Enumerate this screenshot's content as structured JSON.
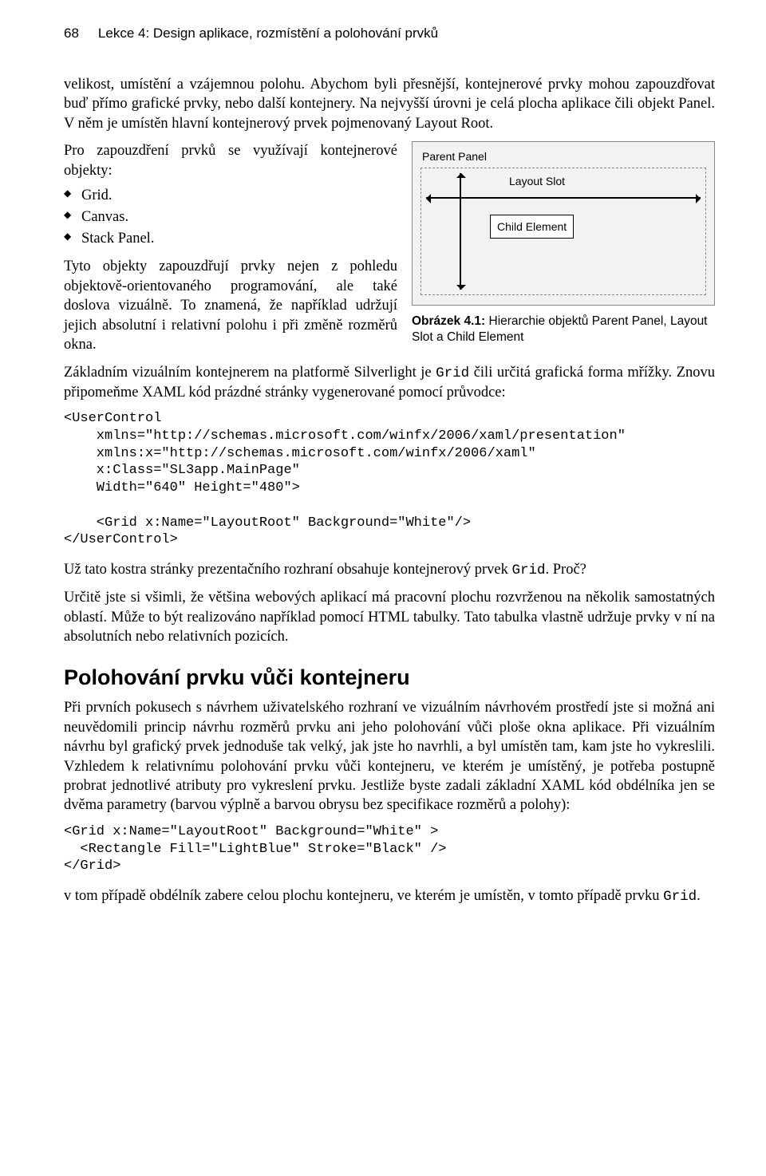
{
  "header": {
    "page_number": "68",
    "title": "Lekce 4: Design aplikace, rozmístění a polohování prvků"
  },
  "p1": "velikost, umístění a vzájemnou polohu. Abychom byli přesnější, kontejnerové prvky mohou zapouzdřovat buď přímo grafické prvky, nebo další kontejnery. Na nejvyšší úrovni je celá plocha aplikace čili objekt Panel. V něm je umístěn hlavní kontejnerový prvek pojmenovaný Layout Root.",
  "p2": "Pro zapouzdření prvků se využívají kontejnerové objekty:",
  "bullets": [
    "Grid.",
    "Canvas.",
    "Stack Panel."
  ],
  "p3": "Tyto objekty zapouzdřují prvky nejen z pohledu objektově-orientovaného programování, ale také doslova vizuálně. To znamená, že například udržují jejich absolutní i relativní polohu i při změně rozměrů okna.",
  "figure": {
    "parent_panel": "Parent Panel",
    "layout_slot": "Layout Slot",
    "child_element": "Child Element",
    "caption_bold": "Obrázek 4.1:",
    "caption_rest": " Hierarchie objektů Parent Panel, Layout Slot a Child Element"
  },
  "p4_pre": "Základním vizuálním kontejnerem na platformě Silverlight je ",
  "p4_code": "Grid",
  "p4_post": " čili určitá grafická forma mřížky. Znovu připomeňme XAML kód prázdné stránky vygenerované pomocí průvodce:",
  "code1": "<UserControl\n    xmlns=\"http://schemas.microsoft.com/winfx/2006/xaml/presentation\"\n    xmlns:x=\"http://schemas.microsoft.com/winfx/2006/xaml\"\n    x:Class=\"SL3app.MainPage\"\n    Width=\"640\" Height=\"480\">\n\n    <Grid x:Name=\"LayoutRoot\" Background=\"White\"/>\n</UserControl>",
  "p5_pre": "Už tato kostra stránky prezentačního rozhraní obsahuje kontejnerový prvek ",
  "p5_code": "Grid",
  "p5_post": ". Proč?",
  "p6": "Určitě jste si všimli, že většina webových aplikací má pracovní plochu rozvrženou na několik samostatných oblastí. Může to být realizováno například pomocí HTML tabulky. Tato tabulka vlastně udržuje prvky v ní na absolutních nebo relativních pozicích.",
  "h2": "Polohování prvku vůči kontejneru",
  "p7": "Při prvních pokusech s návrhem uživatelského rozhraní ve vizuálním návrhovém prostředí jste si možná ani neuvědomili princip návrhu rozměrů prvku ani jeho polohování vůči ploše okna aplikace. Při vizuálním návrhu byl grafický prvek jednoduše tak velký, jak jste ho navrhli, a byl umístěn tam, kam jste ho vykreslili. Vzhledem k relativnímu polohování prvku vůči kontejneru, ve kterém je umístěný, je potřeba postupně probrat jednotlivé atributy pro vykreslení prvku. Jestliže byste zadali základní XAML kód obdélníka jen se dvěma parametry (barvou výplně a barvou obrysu bez specifikace rozměrů a polohy):",
  "code2": "<Grid x:Name=\"LayoutRoot\" Background=\"White\" >\n  <Rectangle Fill=\"LightBlue\" Stroke=\"Black\" />\n</Grid>",
  "p8_pre": "v tom případě obdélník zabere celou plochu kontejneru, ve kterém je umístěn, v tomto případě prvku ",
  "p8_code": "Grid",
  "p8_post": "."
}
